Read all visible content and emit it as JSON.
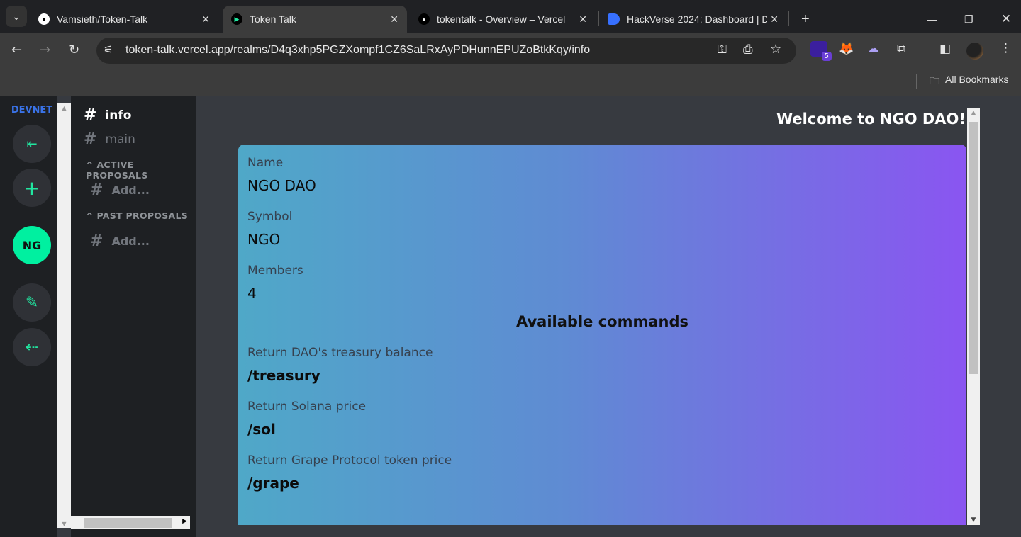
{
  "browser": {
    "tabs": [
      {
        "title": "Vamsieth/Token-Talk",
        "icon": "github-icon"
      },
      {
        "title": "Token Talk",
        "icon": "token-talk-icon",
        "active": true
      },
      {
        "title": "tokentalk - Overview – Vercel",
        "icon": "vercel-icon"
      },
      {
        "title": "HackVerse 2024: Dashboard | D",
        "icon": "devfolio-icon"
      }
    ],
    "url": "token-talk.vercel.app/realms/D4q3xhp5PGZXompf1CZ6SaLRxAyPDHunnEPUZoBtkKqy/info",
    "extension_badge": "5",
    "bookmarks_label": "All Bookmarks"
  },
  "rail": {
    "network": "DEVNET",
    "realm_avatar": "NG",
    "accent": "#21e6a0"
  },
  "channels": {
    "items": [
      {
        "label": "info",
        "active": true
      },
      {
        "label": "main"
      }
    ],
    "sections": [
      {
        "title": "ACTIVE PROPOSALS",
        "items": [
          {
            "label": "Add..."
          }
        ]
      },
      {
        "title": "PAST PROPOSALS",
        "items": [
          {
            "label": "Add..."
          }
        ]
      }
    ]
  },
  "main": {
    "title": "Welcome to NGO DAO!",
    "fields": [
      {
        "label": "Name",
        "value": "NGO DAO"
      },
      {
        "label": "Symbol",
        "value": "NGO"
      },
      {
        "label": "Members",
        "value": "4"
      }
    ],
    "commands_title": "Available commands",
    "commands": [
      {
        "label": "Return DAO's treasury balance",
        "value": "/treasury"
      },
      {
        "label": "Return Solana price",
        "value": "/sol"
      },
      {
        "label": "Return Grape Protocol token price",
        "value": "/grape"
      }
    ]
  }
}
